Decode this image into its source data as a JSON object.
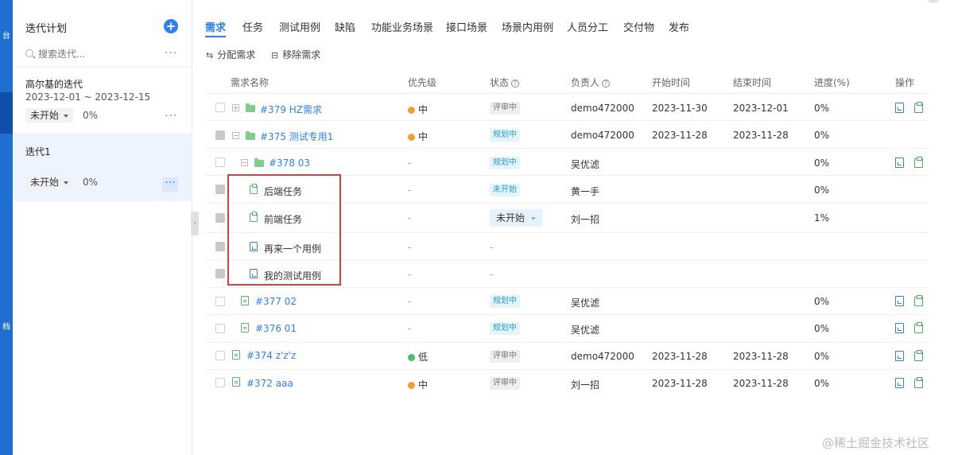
{
  "nav": {
    "labels": [
      "台",
      "档"
    ]
  },
  "sidebar": {
    "title": "迭代计划",
    "search_placeholder": "搜索迭代...",
    "more": "···",
    "iterations": [
      {
        "name": "高尔基的迭代",
        "dates": "2023-12-01 ~ 2023-12-15",
        "status": "未开始",
        "progress": "0%"
      },
      {
        "name": "迭代1",
        "status": "未开始",
        "progress": "0%"
      }
    ]
  },
  "tabs": [
    "需求",
    "任务",
    "测试用例",
    "缺陷",
    "功能业务场景",
    "接口场景",
    "场景内用例",
    "人员分工",
    "交付物",
    "发布"
  ],
  "toolbar": {
    "assign": "分配需求",
    "remove": "移除需求"
  },
  "columns": {
    "name": "需求名称",
    "priority": "优先级",
    "status": "状态",
    "owner": "负责人",
    "start": "开始时间",
    "end": "结束时间",
    "progress": "进度(%)",
    "ops": "操作"
  },
  "rows": [
    {
      "name": "#379 HZ需求",
      "priority": "中",
      "status": "评审中",
      "owner": "demo472000",
      "start": "2023-11-30",
      "end": "2023-12-01",
      "progress": "0%"
    },
    {
      "name": "#375 测试专用1",
      "priority": "中",
      "status": "规划中",
      "owner": "demo472000",
      "start": "2023-11-28",
      "end": "2023-11-28",
      "progress": "0%"
    },
    {
      "name": "#378 03",
      "priority": "-",
      "status": "规划中",
      "owner": "吴优滤",
      "progress": "0%"
    },
    {
      "name": "后端任务",
      "priority": "-",
      "status": "未开始",
      "owner": "黄一手",
      "progress": "0%"
    },
    {
      "name": "前端任务",
      "priority": "-",
      "status": "未开始",
      "owner": "刘一招",
      "progress": "1%"
    },
    {
      "name": "再来一个用例",
      "priority": "-",
      "status": "-"
    },
    {
      "name": "我的测试用例",
      "priority": "-",
      "status": "-"
    },
    {
      "name": "#377 02",
      "priority": "-",
      "status": "规划中",
      "owner": "吴优滤",
      "progress": "0%"
    },
    {
      "name": "#376 01",
      "priority": "-",
      "status": "规划中",
      "owner": "吴优滤",
      "progress": "0%"
    },
    {
      "name": "#374 z'z'z",
      "priority": "低",
      "status": "评审中",
      "owner": "demo472000",
      "start": "2023-11-28",
      "end": "2023-11-28",
      "progress": "0%"
    },
    {
      "name": "#372 aaa",
      "priority": "中",
      "status": "评审中",
      "owner": "刘一招",
      "start": "2023-11-28",
      "end": "2023-11-28",
      "progress": "0%"
    }
  ],
  "colors": {
    "accent": "#2f7ff0",
    "prio_mid": "#f0a030",
    "prio_low": "#4cbf6a",
    "highlight": "#d94040"
  },
  "watermark": "@稀土掘金技术社区"
}
